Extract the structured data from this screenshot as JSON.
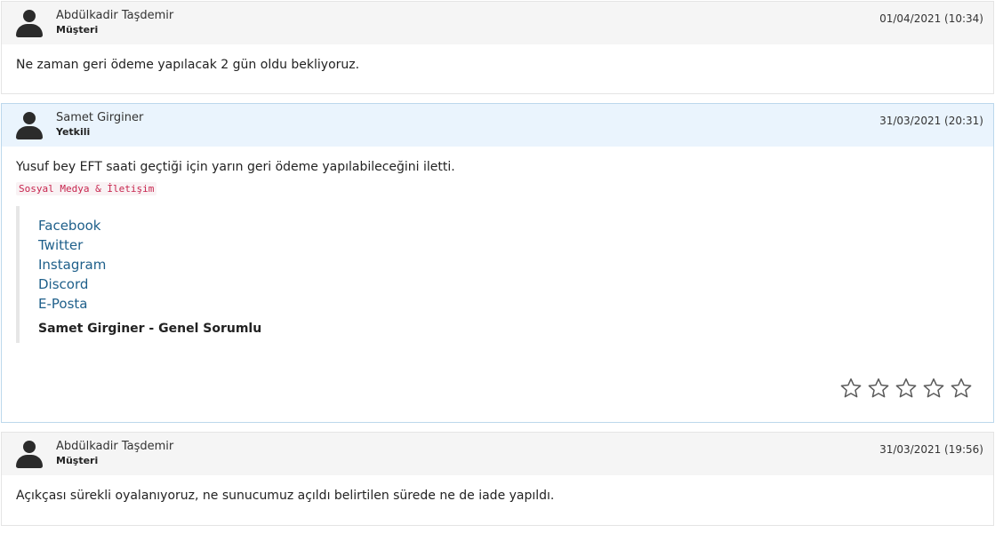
{
  "messages": [
    {
      "author": "Abdülkadir Taşdemir",
      "role": "Müşteri",
      "date": "01/04/2021 (10:34)",
      "text": "Ne zaman geri ödeme yapılacak 2 gün oldu bekliyoruz."
    },
    {
      "author": "Samet Girginer",
      "role": "Yetkili",
      "date": "31/03/2021 (20:31)",
      "text": "Yusuf bey EFT saati geçtiği için yarın geri ödeme yapılabileceğini iletti.",
      "code_tag": "Sosyal Medya & İletişim",
      "links": [
        "Facebook",
        "Twitter",
        "Instagram",
        "Discord",
        "E-Posta"
      ],
      "signature": "Samet Girginer - Genel Sorumlu",
      "rating": {
        "value": 0,
        "max": 5,
        "star_color": "#5a5a5a"
      }
    },
    {
      "author": "Abdülkadir Taşdemir",
      "role": "Müşteri",
      "date": "31/03/2021 (19:56)",
      "text": "Açıkçası sürekli oyalanıyoruz, ne sunucumuz açıldı belirtilen sürede ne de iade yapıldı."
    }
  ],
  "colors": {
    "link": "#1e5f8a",
    "code_tag_text": "#c7254e",
    "staff_header_bg": "#eaf4fd",
    "client_header_bg": "#f5f5f5"
  }
}
